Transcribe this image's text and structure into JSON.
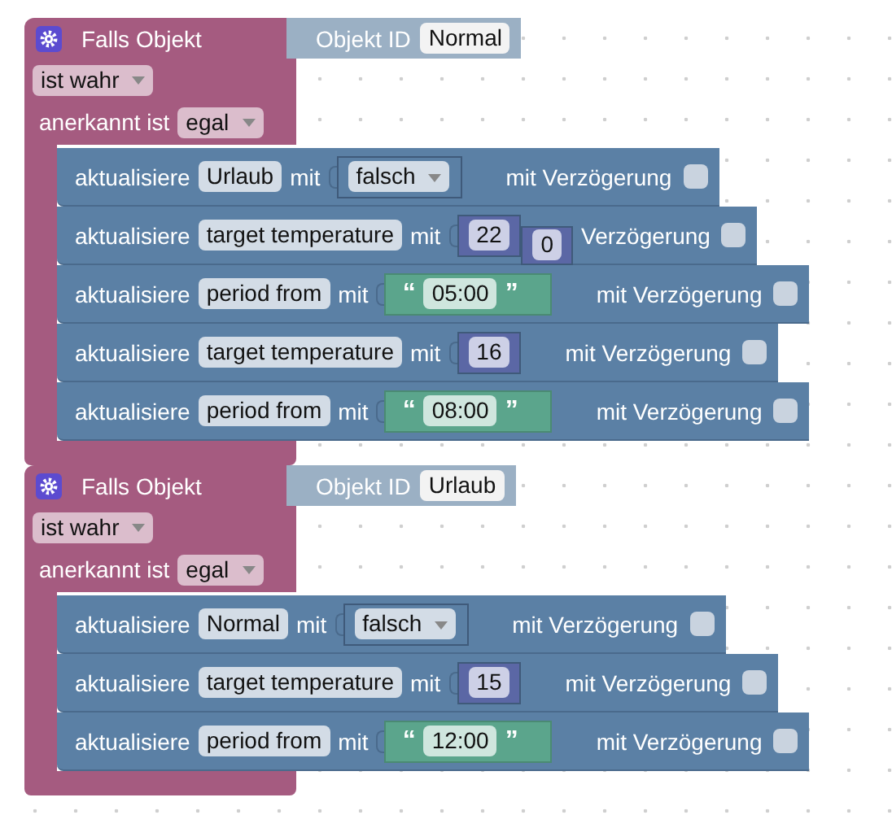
{
  "events": [
    {
      "title": "Falls Objekt",
      "object_label": "Objekt ID",
      "object_value": "Normal",
      "condition": "ist wahr",
      "ack_label": "anerkannt ist",
      "ack_value": "egal",
      "actions": [
        {
          "kind": "dropdown",
          "verb": "aktualisiere",
          "target": "Urlaub",
          "with": "mit",
          "value": "falsch",
          "delay_label": "mit Verzögerung",
          "delay": false
        },
        {
          "kind": "number",
          "verb": "aktualisiere",
          "target": "target temperature",
          "with": "mit",
          "value": "22",
          "extra": "0",
          "delay_label": "Verzögerung",
          "delay": false
        },
        {
          "kind": "text",
          "verb": "aktualisiere",
          "target": "period from",
          "with": "mit",
          "open_quote": "“",
          "value": "05:00",
          "close_quote": "”",
          "delay_label": "mit Verzögerung",
          "delay": false
        },
        {
          "kind": "number",
          "verb": "aktualisiere",
          "target": "target temperature",
          "with": "mit",
          "value": "16",
          "delay_label": "mit Verzögerung",
          "delay": false
        },
        {
          "kind": "text",
          "verb": "aktualisiere",
          "target": "period from",
          "with": "mit",
          "open_quote": "“",
          "value": "08:00",
          "close_quote": "”",
          "delay_label": "mit Verzögerung",
          "delay": false
        }
      ]
    },
    {
      "title": "Falls Objekt",
      "object_label": "Objekt ID",
      "object_value": "Urlaub",
      "condition": "ist wahr",
      "ack_label": "anerkannt ist",
      "ack_value": "egal",
      "actions": [
        {
          "kind": "dropdown",
          "verb": "aktualisiere",
          "target": "Normal",
          "with": "mit",
          "value": "falsch",
          "delay_label": "mit Verzögerung",
          "delay": false
        },
        {
          "kind": "number",
          "verb": "aktualisiere",
          "target": "target temperature",
          "with": "mit",
          "value": "15",
          "delay_label": "mit Verzögerung",
          "delay": false
        },
        {
          "kind": "text",
          "verb": "aktualisiere",
          "target": "period from",
          "with": "mit",
          "open_quote": "“",
          "value": "12:00",
          "close_quote": "”",
          "delay_label": "mit Verzögerung",
          "delay": false
        }
      ]
    }
  ]
}
